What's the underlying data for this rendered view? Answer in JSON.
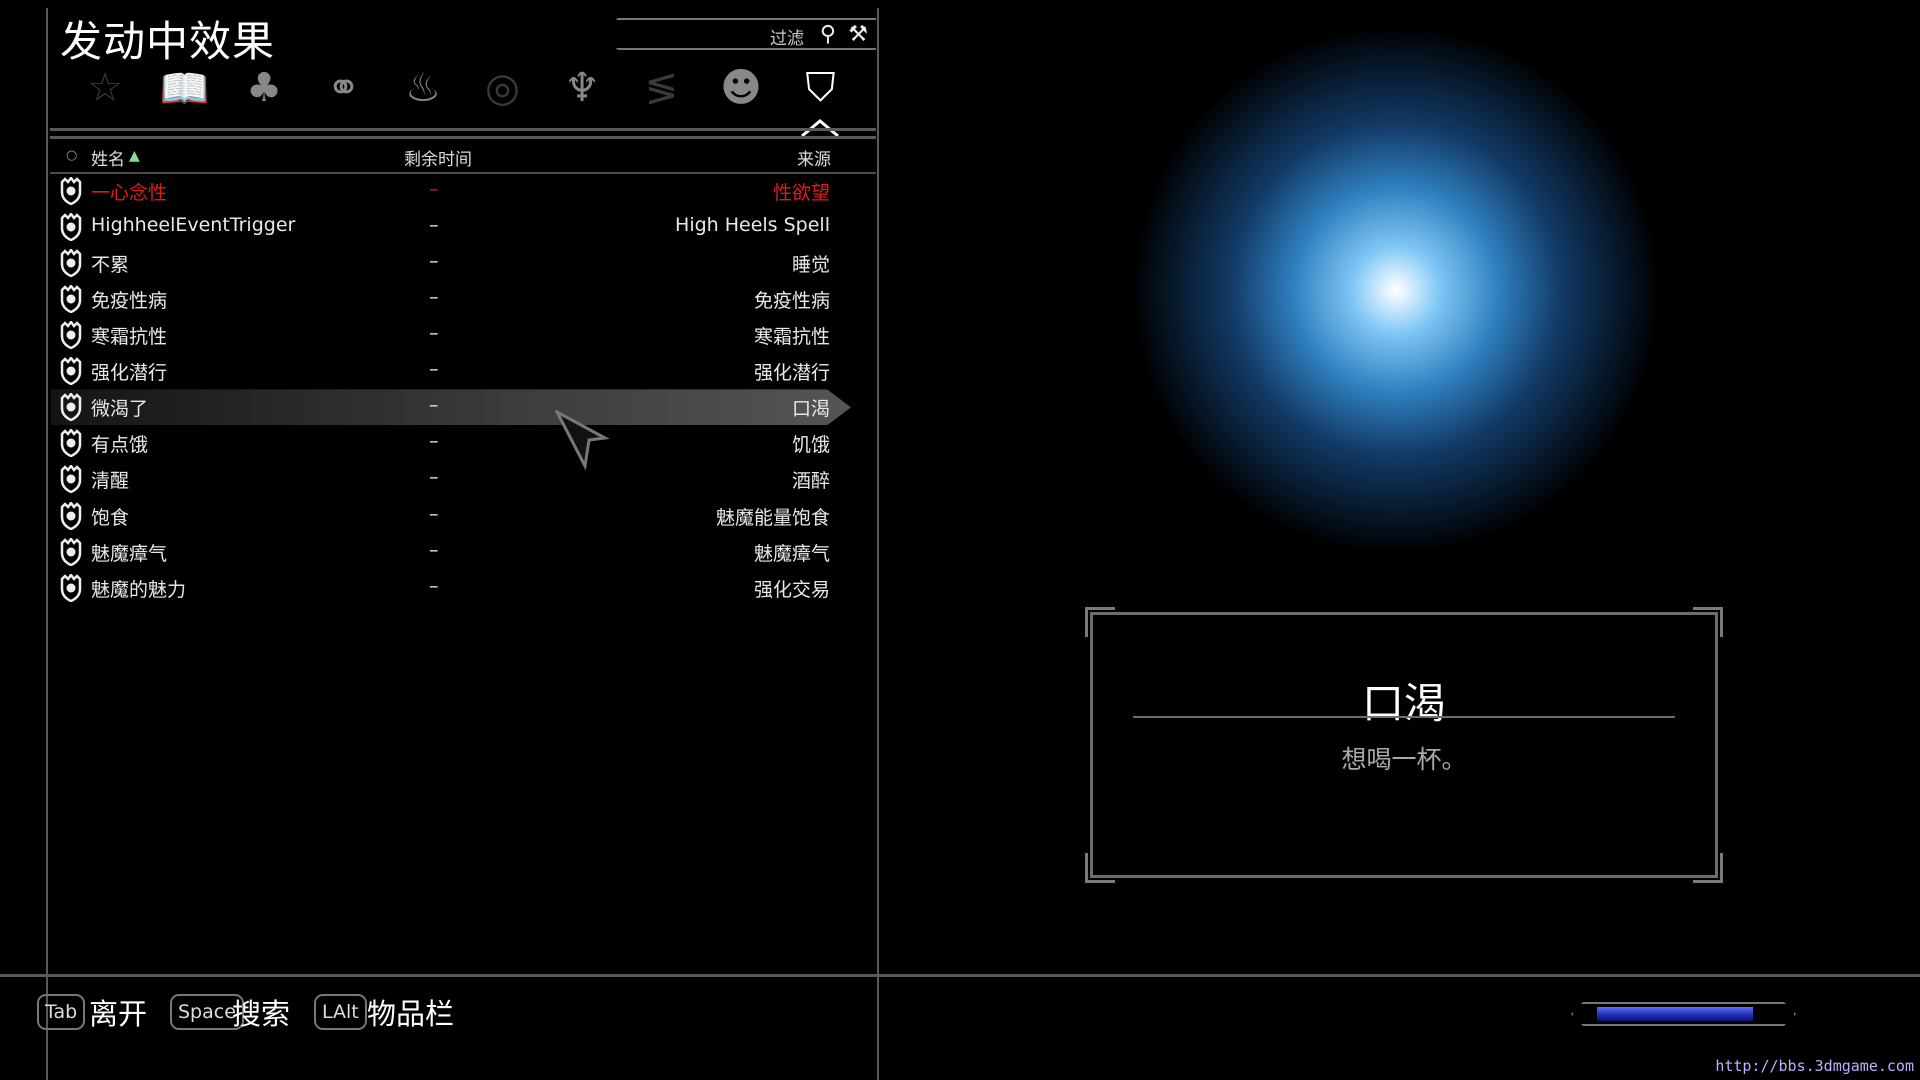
{
  "header": {
    "title": "发动中效果",
    "filter_label": "过滤"
  },
  "categories": [
    {
      "name": "all",
      "icon": "pentagram-icon",
      "glyph": "☆",
      "state": "dim"
    },
    {
      "name": "books",
      "icon": "book-icon",
      "glyph": "📖",
      "state": "normal"
    },
    {
      "name": "tree",
      "icon": "tree-icon",
      "glyph": "♣",
      "state": "normal"
    },
    {
      "name": "trinity",
      "icon": "three-rings-icon",
      "glyph": "⚭",
      "state": "normal"
    },
    {
      "name": "fire",
      "icon": "flame-icon",
      "glyph": "♨",
      "state": "normal"
    },
    {
      "name": "shield",
      "icon": "shield-spiral-icon",
      "glyph": "◎",
      "state": "dim"
    },
    {
      "name": "bird",
      "icon": "eagle-icon",
      "glyph": "♆",
      "state": "normal"
    },
    {
      "name": "script",
      "icon": "rune-icon",
      "glyph": "≶",
      "state": "dim"
    },
    {
      "name": "head",
      "icon": "head-icon",
      "glyph": "☻",
      "state": "normal"
    },
    {
      "name": "crest",
      "icon": "crest-icon",
      "glyph": "⛉",
      "state": "active"
    }
  ],
  "columns": {
    "name": "姓名",
    "time": "剩余时间",
    "source": "来源"
  },
  "effects": [
    {
      "name": "一心念性",
      "time": "–",
      "source": "性欲望",
      "color": "#e01b1b"
    },
    {
      "name": "HighheelEventTrigger",
      "time": "–",
      "source": "High Heels Spell"
    },
    {
      "name": "不累",
      "time": "–",
      "source": "睡觉"
    },
    {
      "name": "免疫性病",
      "time": "–",
      "source": "免疫性病"
    },
    {
      "name": "寒霜抗性",
      "time": "–",
      "source": "寒霜抗性"
    },
    {
      "name": "强化潜行",
      "time": "–",
      "source": "强化潜行"
    },
    {
      "name": "微渴了",
      "time": "–",
      "source": "口渴",
      "selected": true
    },
    {
      "name": "有点饿",
      "time": "–",
      "source": "饥饿"
    },
    {
      "name": "清醒",
      "time": "–",
      "source": "酒醉"
    },
    {
      "name": "饱食",
      "time": "–",
      "source": "魅魔能量饱食"
    },
    {
      "name": "魅魔瘴气",
      "time": "–",
      "source": "魅魔瘴气"
    },
    {
      "name": "魅魔的魅力",
      "time": "–",
      "source": "强化交易"
    }
  ],
  "detail": {
    "title": "口渴",
    "description": "想喝一杯。"
  },
  "footer": {
    "hints": [
      {
        "key": "Tab",
        "label": "离开"
      },
      {
        "key": "Space",
        "label": "搜索"
      },
      {
        "key": "LAlt",
        "label": "物品栏"
      }
    ],
    "magicka_fill": 0.88,
    "magicka_color": "#2a3ad0"
  },
  "watermark": "http://bbs.3dmgame.com"
}
